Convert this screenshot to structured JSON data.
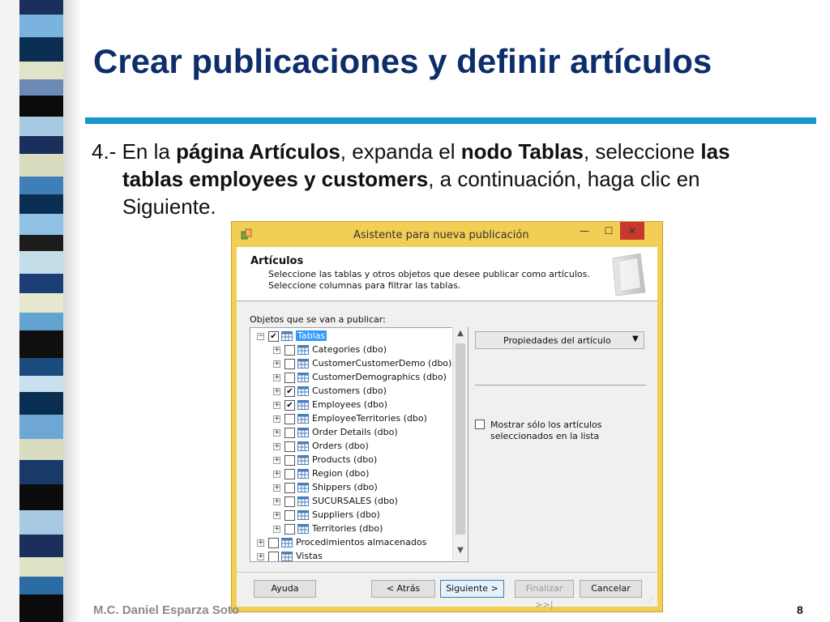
{
  "slide": {
    "title": "Crear publicaciones y definir artículos",
    "step": {
      "prefix": "4.- En la ",
      "b1": "página Artículos",
      "t1": ", expanda el ",
      "b2": "nodo Tablas",
      "t2": ", seleccione ",
      "b3a": "las",
      "b3b": "tablas employees y customers",
      "t3": ", a continuación, haga clic en",
      "t4": "Siguiente."
    },
    "footer_author": "M.C. Daniel Esparza Soto",
    "page_number": "8"
  },
  "dialog": {
    "title": "Asistente para nueva publicación",
    "window_buttons": {
      "minimize": "—",
      "maximize": "☐",
      "close": "✕"
    },
    "header": {
      "title": "Artículos",
      "desc_line1": "Seleccione las tablas y otros objetos que desee publicar como artículos.",
      "desc_line2": "Seleccione columnas para filtrar las tablas."
    },
    "objects_label": "Objetos que se van a publicar:",
    "tree": {
      "root": {
        "label": "Tablas",
        "checked": true
      },
      "tables": [
        {
          "label": "Categories (dbo)",
          "checked": false
        },
        {
          "label": "CustomerCustomerDemo (dbo)",
          "checked": false
        },
        {
          "label": "CustomerDemographics (dbo)",
          "checked": false
        },
        {
          "label": "Customers (dbo)",
          "checked": true
        },
        {
          "label": "Employees (dbo)",
          "checked": true
        },
        {
          "label": "EmployeeTerritories (dbo)",
          "checked": false
        },
        {
          "label": "Order Details (dbo)",
          "checked": false
        },
        {
          "label": "Orders (dbo)",
          "checked": false
        },
        {
          "label": "Products (dbo)",
          "checked": false
        },
        {
          "label": "Region (dbo)",
          "checked": false
        },
        {
          "label": "Shippers (dbo)",
          "checked": false
        },
        {
          "label": "SUCURSALES (dbo)",
          "checked": false
        },
        {
          "label": "Suppliers (dbo)",
          "checked": false
        },
        {
          "label": "Territories (dbo)",
          "checked": false
        }
      ],
      "other_nodes": [
        {
          "label": "Procedimientos almacenados",
          "checked": false
        },
        {
          "label": "Vistas",
          "checked": false
        }
      ]
    },
    "properties_button": "Propiedades del artículo",
    "show_selected_line1": "Mostrar sólo los artículos",
    "show_selected_line2": "seleccionados en la lista",
    "buttons": {
      "help": "Ayuda",
      "back": "< Atrás",
      "next": "Siguiente >",
      "finish": "Finalizar >>|",
      "cancel": "Cancelar"
    }
  },
  "colors": {
    "title": "#0d2d6b",
    "accent_rule": "#1796cc",
    "dialog_frame": "#f2cf54",
    "close_button": "#c7382e",
    "selection": "#3399ff"
  }
}
